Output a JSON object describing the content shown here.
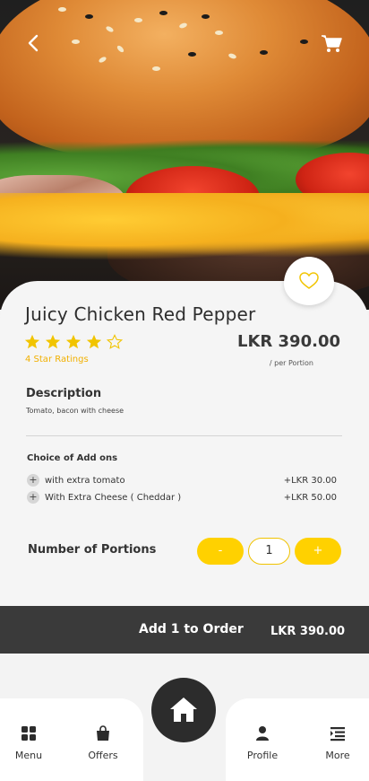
{
  "product": {
    "name": "Juicy Chicken Red Pepper",
    "rating_text": "4 Star Ratings",
    "rating": 4,
    "rating_max": 5,
    "price": "LKR 390.00",
    "price_unit": "/ per Portion"
  },
  "description": {
    "heading": "Description",
    "text": "Tomato, bacon with cheese"
  },
  "addons": {
    "heading": "Choice of Add ons",
    "items": [
      {
        "name": "with extra tomato",
        "price": "+LKR 30.00"
      },
      {
        "name": "With Extra Cheese ( Cheddar )",
        "price": "+LKR 50.00"
      }
    ]
  },
  "portions": {
    "heading": "Number of Portions",
    "minus_label": "-",
    "quantity": "1",
    "plus_label": "+"
  },
  "order": {
    "label": "Add 1 to Order",
    "total": "LKR 390.00"
  },
  "nav": {
    "items": [
      {
        "label": "Menu",
        "icon": "grid-icon"
      },
      {
        "label": "Offers",
        "icon": "shopping-bag-icon"
      },
      {
        "label": "Profile",
        "icon": "user-icon"
      },
      {
        "label": "More",
        "icon": "list-icon"
      }
    ],
    "home_icon": "home-icon"
  },
  "colors": {
    "accent": "#ffd100",
    "star": "#f1b000",
    "order_bar": "#3a3a3a",
    "home_button": "#2c2c2c"
  },
  "icons": {
    "back": "chevron-left-icon",
    "cart": "cart-icon",
    "favorite": "heart-outline-icon"
  }
}
